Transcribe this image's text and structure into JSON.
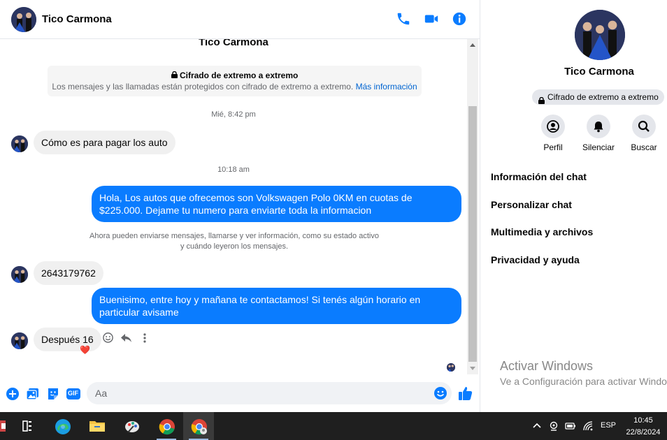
{
  "contact": {
    "name": "Tico Carmona"
  },
  "header": {
    "icons": [
      "phone-icon",
      "video-icon",
      "info-icon"
    ]
  },
  "conversation": {
    "top_name": "Tico Carmona",
    "e2e_title": "Cifrado de extremo a extremo",
    "e2e_text": "Los mensajes y las llamadas están protegidos con cifrado de extremo a extremo.",
    "e2e_link": "Más información",
    "messages": [
      {
        "kind": "timestamp",
        "text": "Mié, 8:42 pm"
      },
      {
        "kind": "incoming",
        "text": "Cómo es para pagar los auto"
      },
      {
        "kind": "timestamp",
        "text": "10:18 am"
      },
      {
        "kind": "outgoing",
        "text": "Hola, Los autos que ofrecemos son Volkswagen Polo 0KM en cuotas de $225.000. Dejame tu numero para enviarte toda la informacion"
      },
      {
        "kind": "system",
        "text_line1": "Ahora pueden enviarse mensajes, llamarse y ver información, como su estado activo",
        "text_line2": "y cuándo leyeron los mensajes."
      },
      {
        "kind": "incoming",
        "text": "2643179762"
      },
      {
        "kind": "outgoing",
        "text": "Buenisimo, entre hoy y mañana te contactamos! Si tenés algún horario en particular avisame"
      },
      {
        "kind": "incoming",
        "text": "Después 16",
        "reaction": "❤️"
      }
    ]
  },
  "composer": {
    "placeholder": "Aa",
    "icons": [
      "add-icon",
      "image-icon",
      "sticker-icon",
      "gif-icon",
      "emoji-icon",
      "like-icon"
    ],
    "gif_label": "GIF"
  },
  "info_panel": {
    "name": "Tico Carmona",
    "badge": "Cifrado de extremo a extremo",
    "actions": [
      {
        "label": "Perfil",
        "icon": "profile-icon"
      },
      {
        "label": "Silenciar",
        "icon": "bell-icon"
      },
      {
        "label": "Buscar",
        "icon": "search-icon"
      }
    ],
    "menu": [
      "Información del chat",
      "Personalizar chat",
      "Multimedia y archivos",
      "Privacidad y ayuda"
    ]
  },
  "watermark": {
    "title": "Activar Windows",
    "subtitle": "Ve a Configuración para activar Windows."
  },
  "taskbar": {
    "apps": [
      "task-view-icon",
      "edge-icon",
      "file-explorer-icon",
      "paint-icon",
      "chrome-icon",
      "chrome-profile-icon"
    ],
    "language": "ESP",
    "time": "10:45",
    "date": "22/8/2024"
  },
  "colors": {
    "accent": "#0a7cff",
    "link": "#0064d1",
    "taskbar": "#1f1f1f"
  }
}
